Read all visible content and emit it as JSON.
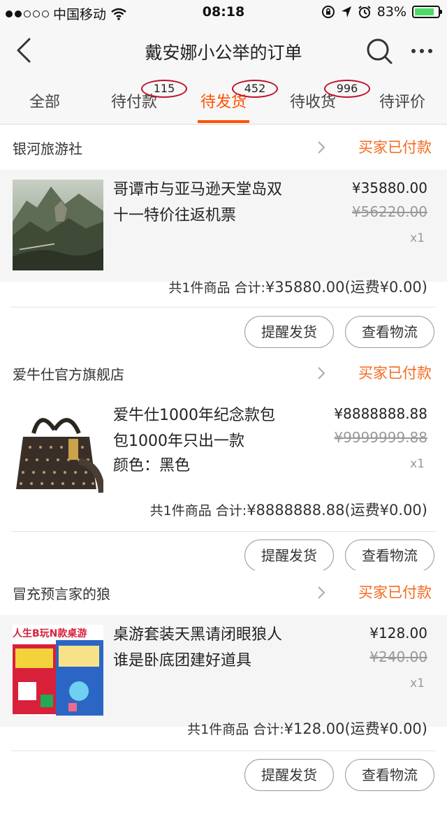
{
  "status_bar": {
    "carrier": "中国移动",
    "time": "08:18",
    "battery": "83%",
    "battery_level": 0.83
  },
  "nav": {
    "title": "戴安娜小公举的订单"
  },
  "tabs": [
    {
      "label": "全部"
    },
    {
      "label": "待付款",
      "badge": "115"
    },
    {
      "label": "待发货",
      "badge": "452",
      "active": true
    },
    {
      "label": "待收货",
      "badge": "996"
    },
    {
      "label": "待评价"
    }
  ],
  "orders": [
    {
      "shop": "银河旅游社",
      "status": "买家已付款",
      "item_name": "哥谭市与亚马逊天堂岛双十一特价往返机票",
      "price": "¥35880.00",
      "old_price": "¥56220.00",
      "qty": "x1",
      "summary_prefix": "共1件商品 合计:",
      "total": "¥35880.00",
      "shipping": "(运费¥0.00)",
      "btn_remind": "提醒发货",
      "btn_logistics": "查看物流"
    },
    {
      "shop": "爱牛仕官方旗舰店",
      "status": "买家已付款",
      "item_name": "爱牛仕1000年纪念款包包1000年只出一款",
      "item_color": "颜色：黑色",
      "price": "¥8888888.88",
      "old_price": "¥9999999.88",
      "qty": "x1",
      "summary_prefix": "共1件商品 合计:",
      "total": "¥8888888.88",
      "shipping": "(运费¥0.00)",
      "btn_remind": "提醒发货",
      "btn_logistics": "查看物流"
    },
    {
      "shop": "冒充预言家的狼",
      "status": "买家已付款",
      "item_name": "桌游套装天黑请闭眼狼人谁是卧底团建好道具",
      "price": "¥128.00",
      "old_price": "¥240.00",
      "qty": "x1",
      "summary_prefix": "共1件商品 合计:",
      "total": "¥128.00",
      "shipping": "(运费¥0.00)",
      "btn_remind": "提醒发货",
      "btn_logistics": "查看物流",
      "box_text": "人生B玩N款桌游"
    }
  ],
  "colors": {
    "accent": "#ff5000",
    "status": "#f56a1e",
    "badge_ring": "#c0102a"
  }
}
